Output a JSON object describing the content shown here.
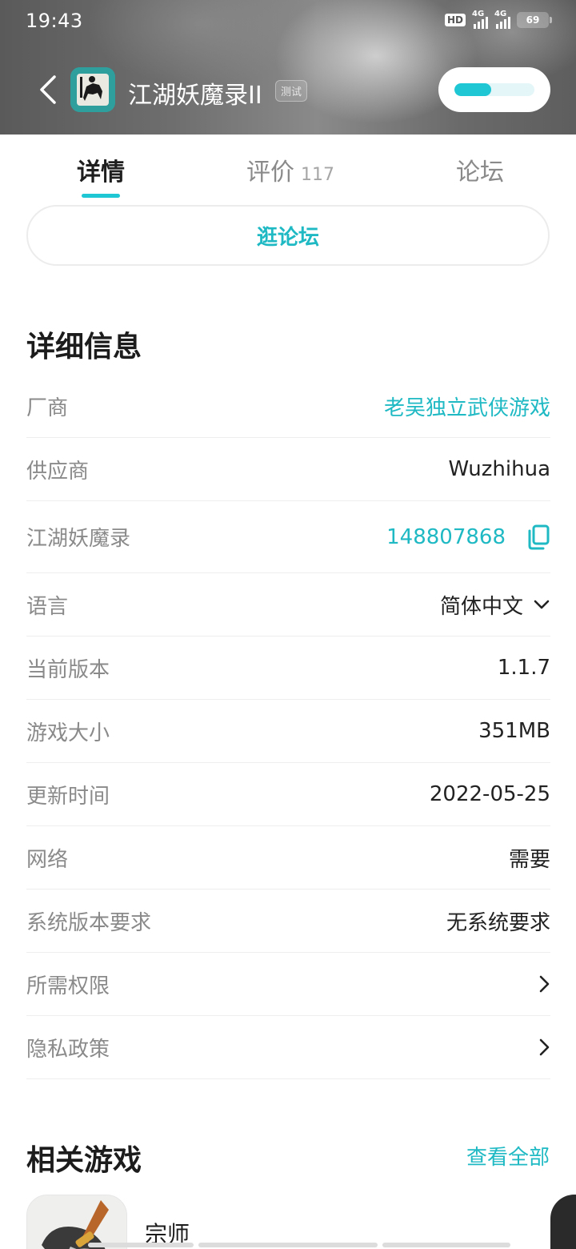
{
  "status_bar": {
    "time": "19:43",
    "hd": "HD",
    "net1": "4G",
    "net2": "4G",
    "battery": "69"
  },
  "header": {
    "app_name": "江湖妖魔录II",
    "badge": "测试",
    "download_progress": 0.46
  },
  "tabs": [
    {
      "label": "详情",
      "active": true
    },
    {
      "label": "评价",
      "count": "117"
    },
    {
      "label": "论坛"
    }
  ],
  "forum_button": "逛论坛",
  "details": {
    "title": "详细信息",
    "rows": [
      {
        "label": "厂商",
        "value": "老吴独立武侠游戏",
        "kind": "link"
      },
      {
        "label": "供应商",
        "value": "Wuzhihua"
      },
      {
        "label": "江湖妖魔录",
        "value": "148807868",
        "kind": "copy"
      },
      {
        "label": "语言",
        "value": "简体中文",
        "kind": "dropdown"
      },
      {
        "label": "当前版本",
        "value": "1.1.7"
      },
      {
        "label": "游戏大小",
        "value": "351MB"
      },
      {
        "label": "更新时间",
        "value": "2022-05-25"
      },
      {
        "label": "网络",
        "value": "需要"
      },
      {
        "label": "系统版本要求",
        "value": "无系统要求"
      },
      {
        "label": "所需权限",
        "value": "",
        "kind": "arrow"
      },
      {
        "label": "隐私政策",
        "value": "",
        "kind": "arrow"
      }
    ]
  },
  "related": {
    "title": "相关游戏",
    "see_all": "查看全部",
    "games": [
      {
        "name": "宗师"
      }
    ]
  },
  "colors": {
    "accent": "#1fc6d4",
    "link": "#1fb9c4"
  }
}
